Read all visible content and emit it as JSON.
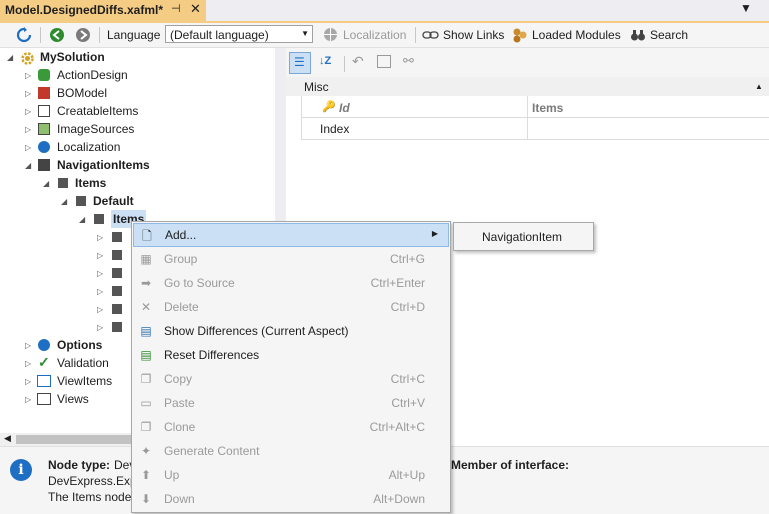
{
  "tab": {
    "title": "Model.DesignedDiffs.xafml*",
    "pin_icon": "pin-icon",
    "close_icon": "close-icon"
  },
  "toolbar": {
    "language_label": "Language",
    "language_value": "(Default language)",
    "localization_label": "Localization",
    "show_links_label": "Show Links",
    "loaded_modules_label": "Loaded Modules",
    "search_label": "Search"
  },
  "tree": {
    "root": "MySolution",
    "items": [
      {
        "label": "ActionDesign",
        "bold": false
      },
      {
        "label": "BOModel",
        "bold": false
      },
      {
        "label": "CreatableItems",
        "bold": false
      },
      {
        "label": "ImageSources",
        "bold": false
      },
      {
        "label": "Localization",
        "bold": false
      },
      {
        "label": "NavigationItems",
        "bold": true
      },
      {
        "label": "Items",
        "bold": true
      },
      {
        "label": "Default",
        "bold": true
      },
      {
        "label": "Items",
        "bold": true
      },
      {
        "label": "Options",
        "bold": true
      },
      {
        "label": "Validation",
        "bold": false
      },
      {
        "label": "ViewItems",
        "bold": false
      },
      {
        "label": "Views",
        "bold": false
      }
    ]
  },
  "properties": {
    "category": "Misc",
    "header_id": "Id",
    "header_items": "Items",
    "row_index": "Index"
  },
  "context_menu": {
    "items": [
      {
        "label": "Add...",
        "shortcut": "",
        "enabled": true,
        "icon": "new-document-icon"
      },
      {
        "label": "Group",
        "shortcut": "Ctrl+G",
        "enabled": false,
        "icon": "group-icon"
      },
      {
        "label": "Go to Source",
        "shortcut": "Ctrl+Enter",
        "enabled": false,
        "icon": "arrow-right-icon"
      },
      {
        "label": "Delete",
        "shortcut": "Ctrl+D",
        "enabled": false,
        "icon": "delete-icon"
      },
      {
        "label": "Show Differences (Current Aspect)",
        "shortcut": "",
        "enabled": true,
        "icon": "diff-icon"
      },
      {
        "label": "Reset Differences",
        "shortcut": "",
        "enabled": true,
        "icon": "reset-diff-icon"
      },
      {
        "label": "Copy",
        "shortcut": "Ctrl+C",
        "enabled": false,
        "icon": "copy-icon"
      },
      {
        "label": "Paste",
        "shortcut": "Ctrl+V",
        "enabled": false,
        "icon": "paste-icon"
      },
      {
        "label": "Clone",
        "shortcut": "Ctrl+Alt+C",
        "enabled": false,
        "icon": "clone-icon"
      },
      {
        "label": "Generate Content",
        "shortcut": "",
        "enabled": false,
        "icon": "magic-wand-icon"
      },
      {
        "label": "Up",
        "shortcut": "Alt+Up",
        "enabled": false,
        "icon": "arrow-up-icon"
      },
      {
        "label": "Down",
        "shortcut": "Alt+Down",
        "enabled": false,
        "icon": "arrow-down-icon"
      }
    ],
    "submenu_item": "NavigationItem"
  },
  "info": {
    "node_type_label": "Node type:",
    "node_type_value": "Dev",
    "line2": "DevExpress.Expr",
    "line3": "The Items node c",
    "member_label": "Member of interface:"
  },
  "colors": {
    "tab_active": "#f5cc84",
    "menu_highlight": "#cce0f5",
    "info_icon": "#1e6fc4"
  }
}
